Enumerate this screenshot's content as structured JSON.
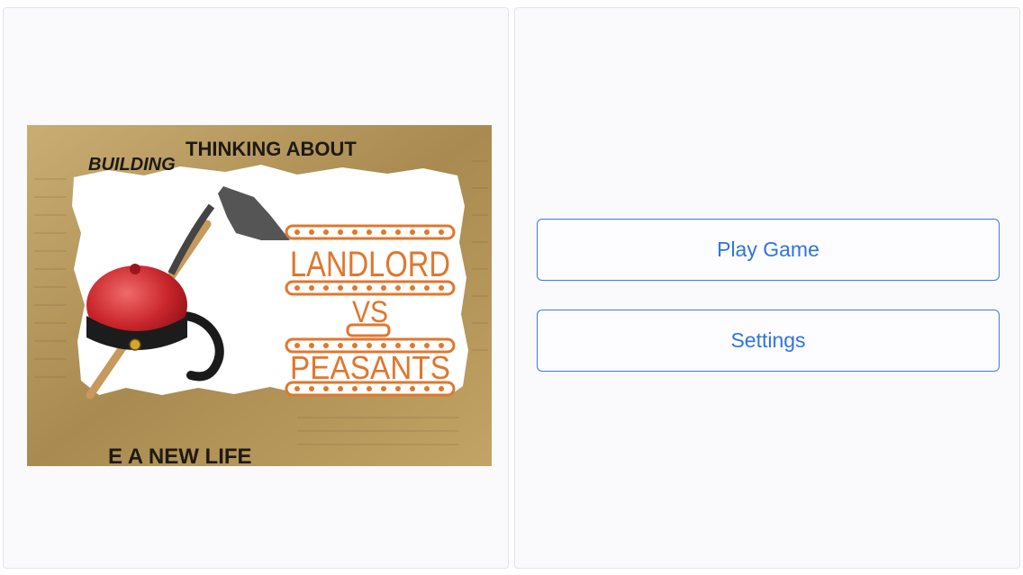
{
  "cover": {
    "newspaper_headline_1": "THINKING  ABOUT",
    "newspaper_headline_2": "BUILDING",
    "newspaper_headline_3": "E A NEW LIFE",
    "title_line_1": "LANDLORD",
    "title_line_2": "VS",
    "title_line_3": "PEASANTS"
  },
  "menu": {
    "play_label": "Play Game",
    "settings_label": "Settings"
  },
  "colors": {
    "accent": "#2f74e0",
    "title_orange": "#e0772e",
    "paper": "#b89a5e",
    "hat_red": "#c8242a"
  }
}
